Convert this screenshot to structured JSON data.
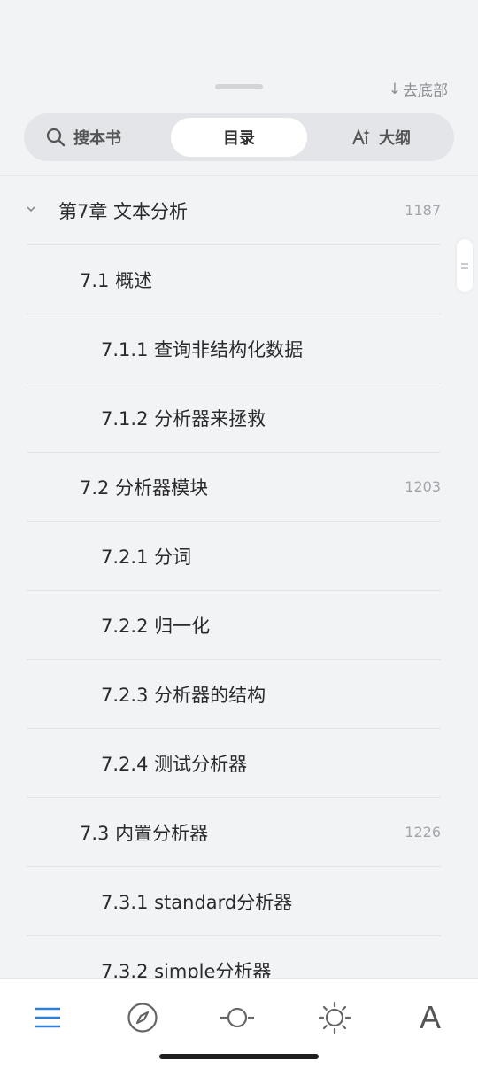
{
  "header": {
    "go_bottom_label": "去底部"
  },
  "tabs": {
    "search_label": "搜本书",
    "toc_label": "目录",
    "outline_label": "大纲"
  },
  "toc": {
    "items": [
      {
        "title": "第7章 文本分析",
        "page": "1187"
      },
      {
        "title": "7.1 概述",
        "page": ""
      },
      {
        "title": "7.1.1 查询非结构化数据",
        "page": ""
      },
      {
        "title": "7.1.2 分析器来拯救",
        "page": ""
      },
      {
        "title": "7.2 分析器模块",
        "page": "1203"
      },
      {
        "title": "7.2.1 分词",
        "page": ""
      },
      {
        "title": "7.2.2 归一化",
        "page": ""
      },
      {
        "title": "7.2.3 分析器的结构",
        "page": ""
      },
      {
        "title": "7.2.4 测试分析器",
        "page": ""
      },
      {
        "title": "7.3 内置分析器",
        "page": "1226"
      },
      {
        "title": "7.3.1 standard分析器",
        "page": ""
      },
      {
        "title": "7.3.2 simple分析器",
        "page": ""
      }
    ]
  },
  "toolbar": {
    "icons": [
      "menu-icon",
      "compass-icon",
      "progress-icon",
      "brightness-icon",
      "font-icon"
    ],
    "font_glyph": "A",
    "accent_color": "#2E7FD6"
  }
}
